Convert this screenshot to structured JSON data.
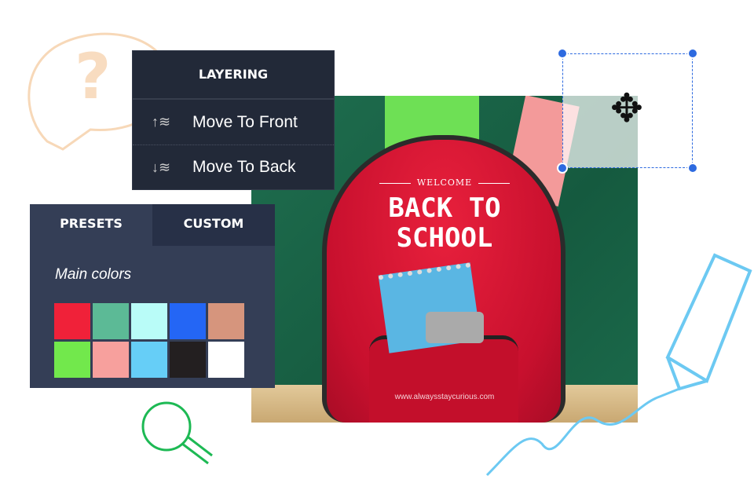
{
  "layering": {
    "title": "LAYERING",
    "items": [
      {
        "label": "Move To Front",
        "icon": "arrow-up-layers-icon",
        "arrow": "↑"
      },
      {
        "label": "Move To Back",
        "icon": "arrow-down-layers-icon",
        "arrow": "↓"
      }
    ]
  },
  "color_panel": {
    "tabs": [
      {
        "label": "PRESETS",
        "active": true
      },
      {
        "label": "CUSTOM",
        "active": false
      }
    ],
    "section_label": "Main colors",
    "swatches": [
      "#f02139",
      "#5cba96",
      "#b9fcf8",
      "#2466f5",
      "#d6957d",
      "#72e84c",
      "#f7a09d",
      "#66cef7",
      "#231f20",
      "#ffffff"
    ]
  },
  "poster": {
    "welcome": "WELCOME",
    "title": "BACK TO SCHOOL",
    "url": "www.alwaysstaycurious.com"
  },
  "selection": {
    "icon": "move-icon",
    "color": "#2d6ae0"
  }
}
